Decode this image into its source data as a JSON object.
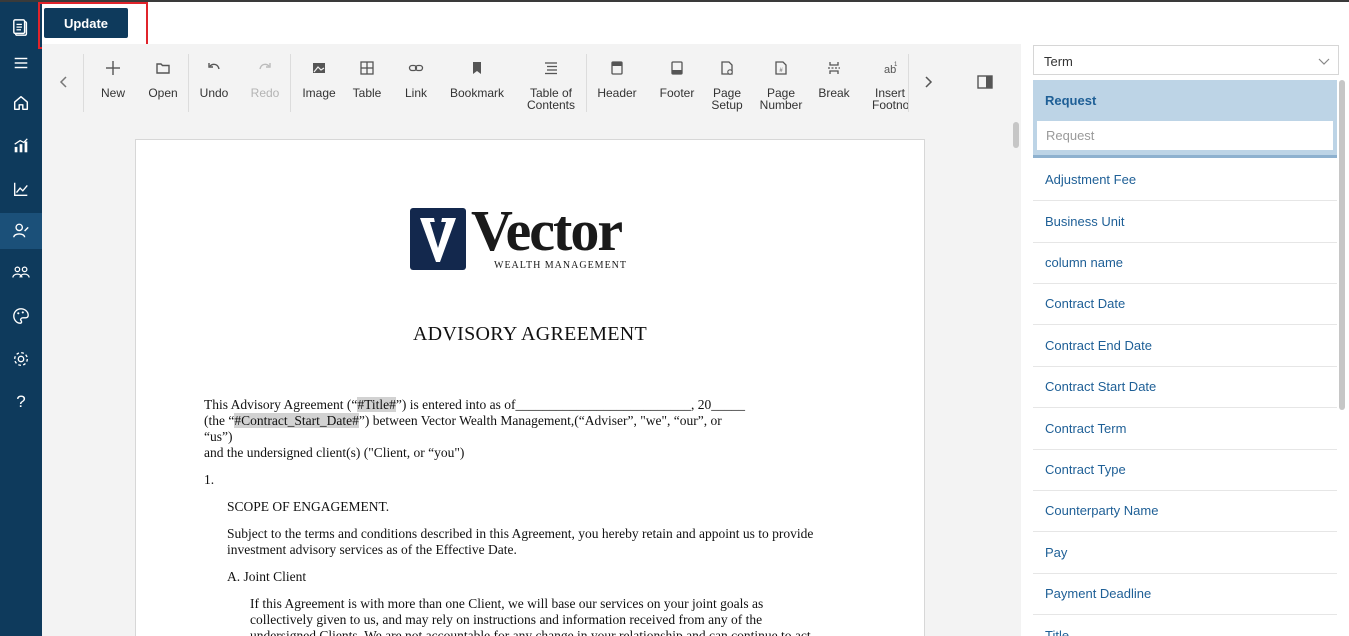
{
  "app": {
    "update_label": "Update"
  },
  "sidenav": {
    "items": [
      "logo-icon",
      "menu-icon",
      "home-icon",
      "analytics-icon",
      "trend-chart-icon",
      "user-config-icon",
      "team-icon",
      "palette-icon",
      "settings-icon",
      "help-icon"
    ],
    "help_glyph": "?"
  },
  "toolbar": {
    "new": "New",
    "open": "Open",
    "undo": "Undo",
    "redo": "Redo",
    "image": "Image",
    "table": "Table",
    "link": "Link",
    "bookmark": "Bookmark",
    "toc": "Table of Contents",
    "header": "Header",
    "footer": "Footer",
    "page_setup": "Page Setup",
    "page_number": "Page Number",
    "break": "Break",
    "insert_footnote": "Insert Footnot"
  },
  "document": {
    "logo_word": "Vector",
    "logo_sub": "WEALTH MANAGEMENT",
    "title": "ADVISORY AGREEMENT",
    "p1_a": "This Advisory Agreement (“",
    "p1_title_tag": "#Title#",
    "p1_b": "”) is entered into as of__________________________, 20_____",
    "p2_a": "(the “",
    "p2_tag": "#Contract_Start_Date#",
    "p2_b": "”) between Vector Wealth Management,(“Adviser”, \"we\", “our”, or",
    "p3": "“us”)",
    "p4": "and the undersigned client(s) (\"Client, or “you\")",
    "num1": "1.",
    "scope": "SCOPE OF ENGAGEMENT.",
    "subj1": "Subject to the terms and conditions described in this Agreement, you hereby retain and appoint us to provide",
    "subj2": "investment advisory services as of the Effective Date.",
    "jc": "A.   Joint Client",
    "jc1": "If this Agreement is with more than one Client, we will base our services on your joint goals as",
    "jc2": "collectively given to us, and may rely on instructions and information received from any of the",
    "jc3": "undersigned Clients. We are not accountable for any change in your relationship and can continue to act"
  },
  "right_panel": {
    "select_value": "Term",
    "section_title": "Request",
    "search_placeholder": "Request",
    "fields": [
      "Adjustment Fee",
      "Business Unit",
      "column name",
      "Contract Date",
      "Contract End Date",
      "Contract Start Date",
      "Contract Term",
      "Contract Type",
      "Counterparty Name",
      "Pay",
      "Payment Deadline",
      "Title"
    ]
  }
}
